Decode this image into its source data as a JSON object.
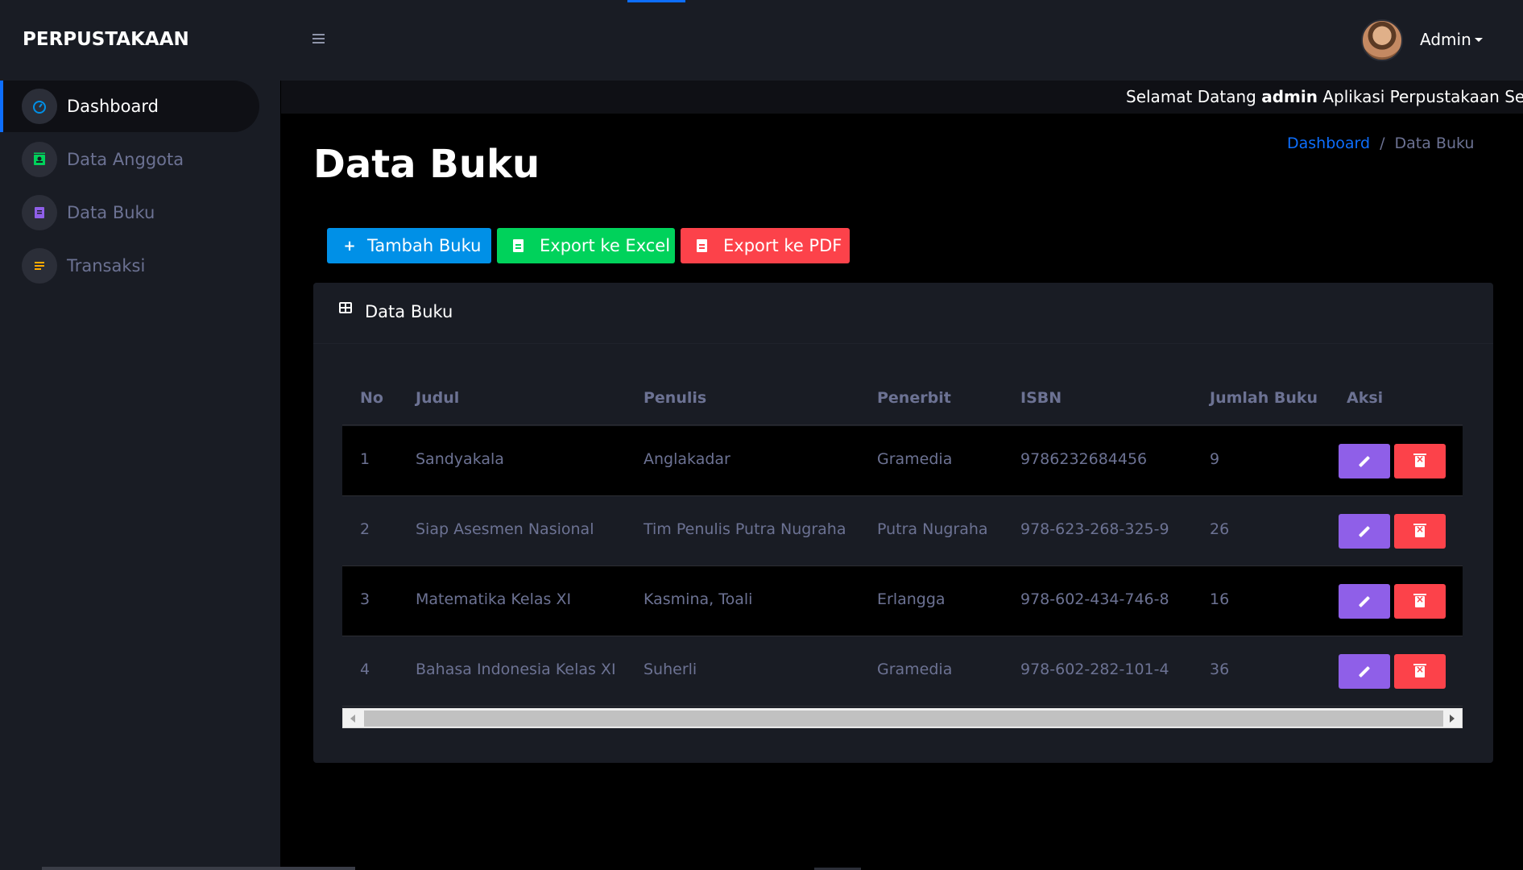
{
  "app": {
    "brand": "PERPUSTAKAAN",
    "user_name": "Admin"
  },
  "sidebar": {
    "items": [
      {
        "label": "Dashboard",
        "icon": "speedometer-icon",
        "icon_color": "#0090e7",
        "active": true
      },
      {
        "label": "Data Anggota",
        "icon": "contacts-icon",
        "icon_color": "#00d25b",
        "active": false
      },
      {
        "label": "Data Buku",
        "icon": "book-icon",
        "icon_color": "#8f5fe8",
        "active": false
      },
      {
        "label": "Transaksi",
        "icon": "list-icon",
        "icon_color": "#ffab00",
        "active": false
      }
    ]
  },
  "marquee": {
    "prefix": "Selamat Datang ",
    "user": "admin",
    "suffix": " Aplikasi Perpustakaan Sed"
  },
  "page": {
    "title": "Data Buku",
    "breadcrumb": {
      "home": "Dashboard",
      "separator": "/",
      "current": "Data Buku"
    }
  },
  "actions": {
    "add_label": "Tambah Buku",
    "excel_label": "Export ke Excel",
    "pdf_label": "Export ke PDF"
  },
  "card": {
    "title": "Data Buku"
  },
  "table": {
    "headers": [
      "No",
      "Judul",
      "Penulis",
      "Penerbit",
      "ISBN",
      "Jumlah Buku",
      "Aksi"
    ],
    "rows": [
      [
        "1",
        "Sandyakala",
        "Anglakadar",
        "Gramedia",
        "9786232684456",
        "9"
      ],
      [
        "2",
        "Siap Asesmen Nasional",
        "Tim Penulis Putra Nugraha",
        "Putra Nugraha",
        "978-623-268-325-9",
        "26"
      ],
      [
        "3",
        "Matematika Kelas XI",
        "Kasmina, Toali",
        "Erlangga",
        "978-602-434-746-8",
        "16"
      ],
      [
        "4",
        "Bahasa Indonesia Kelas XI",
        "Suherli",
        "Gramedia",
        "978-602-282-101-4",
        "36"
      ]
    ]
  },
  "colors": {
    "background": "#000000",
    "panel": "#191c24",
    "primary": "#0d6efd",
    "info": "#0090e7",
    "success": "#00d25b",
    "danger": "#fc424a",
    "purple": "#8f5fe8",
    "muted": "#6c7293"
  }
}
